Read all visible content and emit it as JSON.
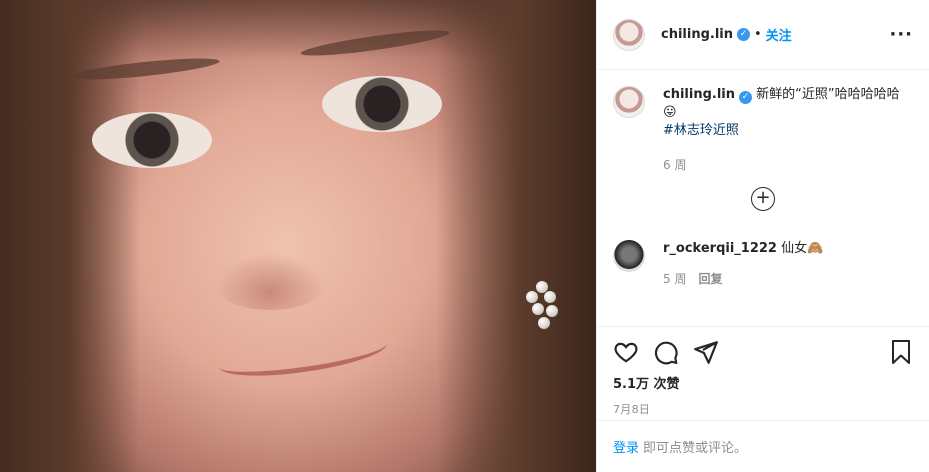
{
  "header": {
    "username": "chiling.lin",
    "verified_mark": "✓",
    "separator": "•",
    "follow_label": "关注",
    "more_label": "···"
  },
  "caption": {
    "username": "chiling.lin",
    "text": "新鲜的“近照”哈哈哈哈哈",
    "emoji": "😛",
    "hashtag": "#林志玲近照",
    "age": "6 周"
  },
  "load_more_label": "+",
  "comments": [
    {
      "username": "r_ockerqii_1222",
      "text": "仙女🙈",
      "age": "5 周",
      "reply_label": "回复"
    }
  ],
  "actions": {
    "like_icon": "heart-icon",
    "comment_icon": "comment-icon",
    "share_icon": "share-icon",
    "save_icon": "bookmark-icon"
  },
  "views": "5.1万 次赞",
  "date": "7月8日",
  "login": {
    "link_label": "登录",
    "prompt": "即可点赞或评论。"
  }
}
